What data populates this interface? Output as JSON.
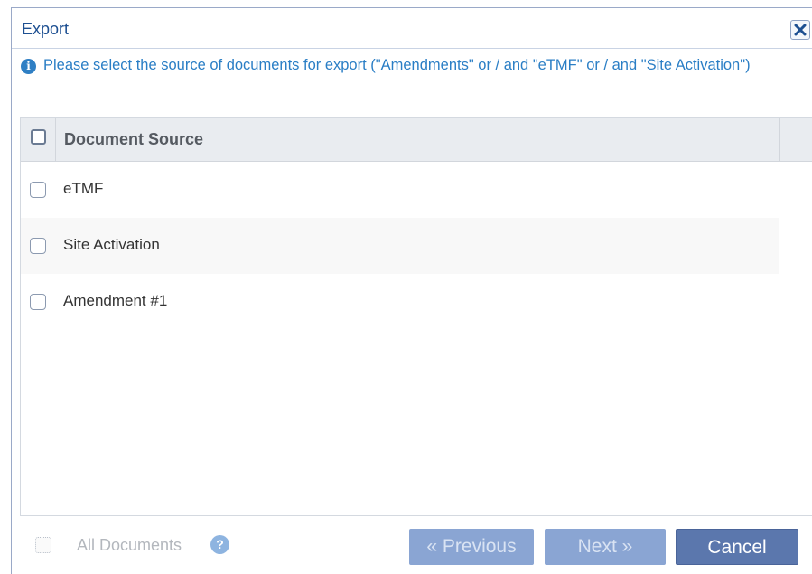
{
  "dialog": {
    "title": "Export",
    "close_icon": "close-icon"
  },
  "info": {
    "icon": "info-icon",
    "message": "Please select the source of documents for export (\"Amendments\" or / and \"eTMF\" or / and \"Site Activation\")"
  },
  "grid": {
    "header": "Document Source",
    "rows": [
      {
        "label": "eTMF",
        "checked": false
      },
      {
        "label": "Site Activation",
        "checked": false
      },
      {
        "label": "Amendment #1",
        "checked": false
      }
    ]
  },
  "footer": {
    "all_documents_label": "All Documents",
    "help_icon": "help-icon",
    "previous_label": "« Previous",
    "next_label": "Next »",
    "cancel_label": "Cancel"
  },
  "colors": {
    "title": "#1d4f91",
    "info_text": "#2a7ec5",
    "button_disabled": "#8aa5d3",
    "button_primary": "#5b77ad"
  }
}
